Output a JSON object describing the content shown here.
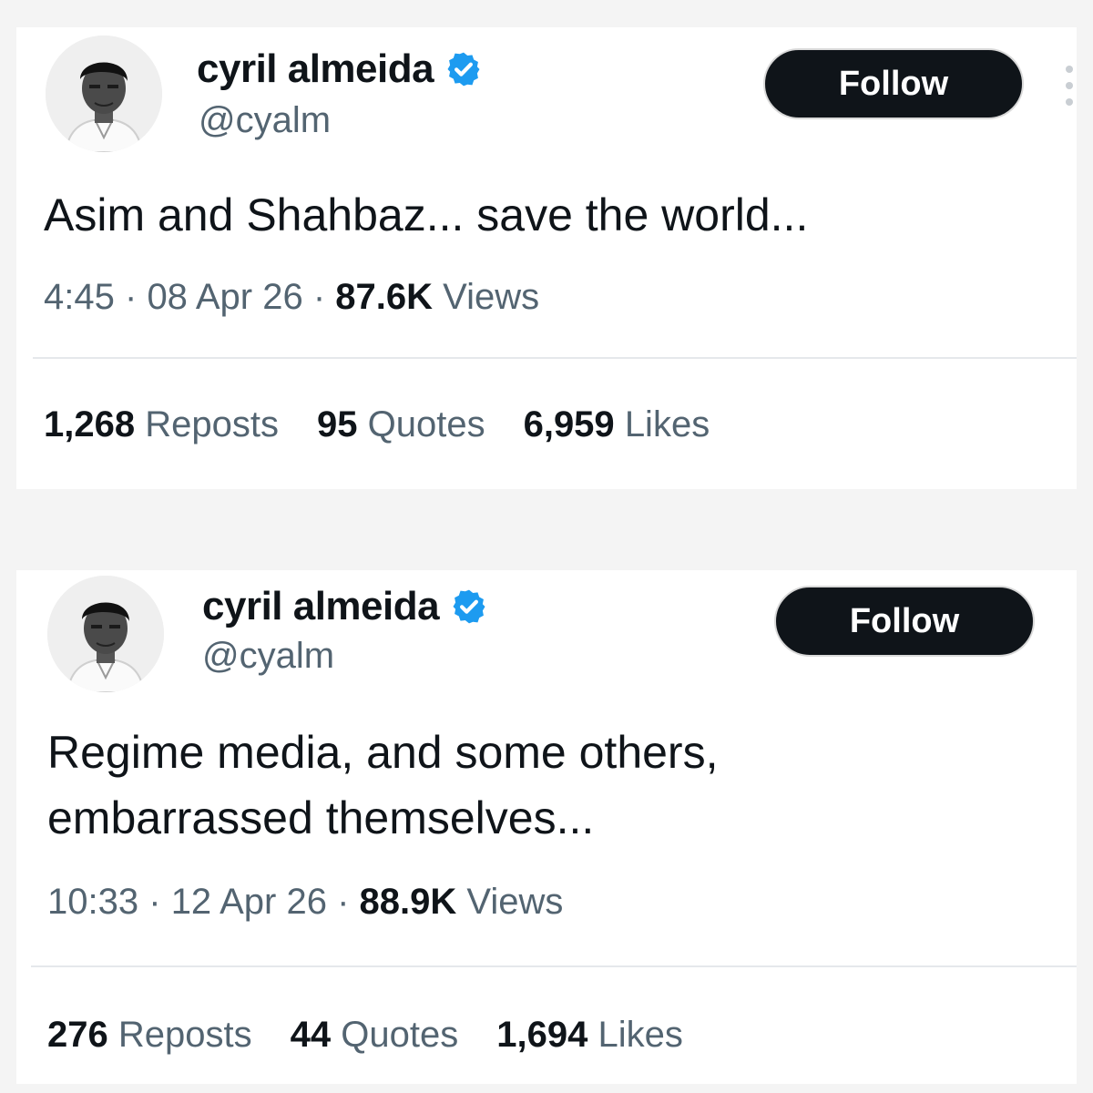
{
  "tweets": [
    {
      "author": {
        "name": "cyril almeida",
        "handle": "@cyalm"
      },
      "follow_label": "Follow",
      "text": [
        "Asim and Shahbaz... save the world..."
      ],
      "time": "4:45",
      "date": "08 Apr 26",
      "views_count": "87.6K",
      "views_label": "Views",
      "stats": {
        "reposts": "1,268",
        "reposts_label": "Reposts",
        "quotes": "95",
        "quotes_label": "Quotes",
        "likes": "6,959",
        "likes_label": "Likes"
      }
    },
    {
      "author": {
        "name": "cyril almeida",
        "handle": "@cyalm"
      },
      "follow_label": "Follow",
      "text": [
        "Regime media, and some others,",
        "embarrassed themselves..."
      ],
      "time": "10:33",
      "date": "12 Apr 26",
      "views_count": "88.9K",
      "views_label": "Views",
      "stats": {
        "reposts": "276",
        "reposts_label": "Reposts",
        "quotes": "44",
        "quotes_label": "Quotes",
        "likes": "1,694",
        "likes_label": "Likes"
      }
    }
  ],
  "separator": "·",
  "colors": {
    "verified_badge": "#1d9bf0",
    "follow_button": "#0f1419",
    "secondary_text": "#536471",
    "primary_text": "#0f1419"
  },
  "icons": {
    "verified": "verified-badge-icon",
    "more": "more-options-icon"
  }
}
